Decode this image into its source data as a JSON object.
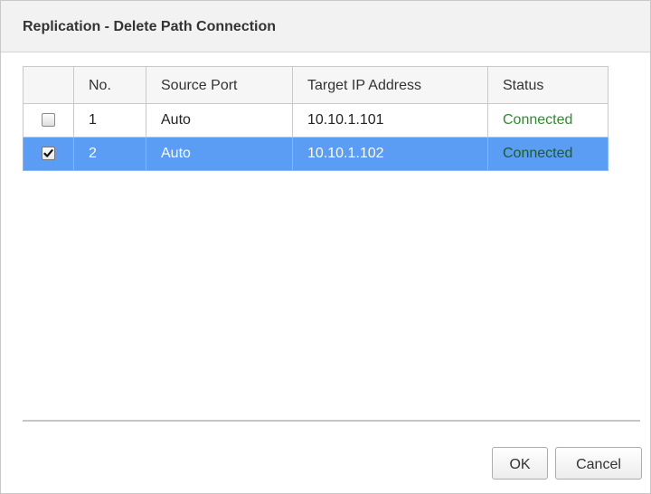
{
  "dialog": {
    "title": "Replication - Delete Path Connection"
  },
  "table": {
    "columns": [
      "No.",
      "Source Port",
      "Target IP Address",
      "Status"
    ],
    "rows": [
      {
        "checked": false,
        "no": "1",
        "source_port": "Auto",
        "target_ip": "10.10.1.101",
        "status": "Connected",
        "selected": false
      },
      {
        "checked": true,
        "no": "2",
        "source_port": "Auto",
        "target_ip": "10.10.1.102",
        "status": "Connected",
        "selected": true
      }
    ]
  },
  "buttons": {
    "ok_label": "OK",
    "cancel_label": "Cancel"
  },
  "colors": {
    "selection": "#5b9cf4",
    "status_connected": "#2e8b2e"
  }
}
